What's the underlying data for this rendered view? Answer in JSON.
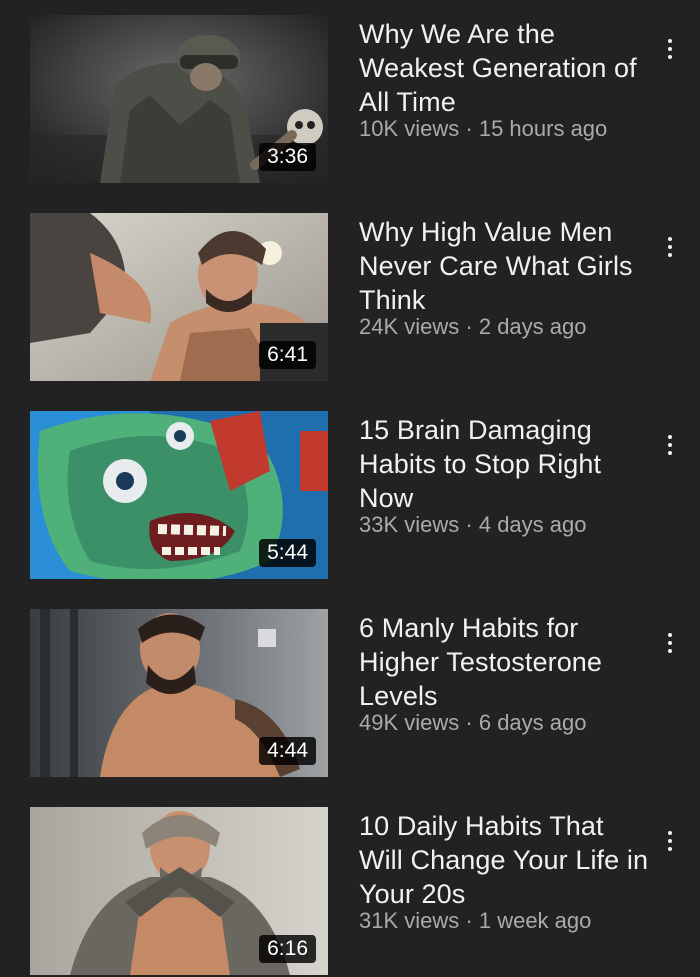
{
  "theme": {
    "background": "#222222",
    "title_color": "#f1f1f1",
    "meta_color": "#aaaaaa"
  },
  "videos": [
    {
      "title": "Why We Are the Weakest Generation of All Time",
      "views": "10K views",
      "age": "15 hours ago",
      "duration": "3:36",
      "thumbnail": "soldier-holding-skull"
    },
    {
      "title": "Why High Value Men Never Care What Girls Think",
      "views": "24K views",
      "age": "2 days ago",
      "duration": "6:41",
      "thumbnail": "bearded-man-at-gym"
    },
    {
      "title": "15 Brain Damaging Habits to Stop Right Now",
      "views": "33K views",
      "age": "4 days ago",
      "duration": "5:44",
      "thumbnail": "green-zombie-face"
    },
    {
      "title": "6 Manly Habits for Higher Testosterone Levels",
      "views": "49K views",
      "age": "6 days ago",
      "duration": "4:44",
      "thumbnail": "shirtless-bearded-man"
    },
    {
      "title": "10 Daily Habits That Will Change Your Life in Your 20s",
      "views": "31K views",
      "age": "1 week ago",
      "duration": "6:16",
      "thumbnail": "man-lifting-shirt"
    }
  ],
  "separator": " · ",
  "menu_icon": "more-vertical-icon"
}
